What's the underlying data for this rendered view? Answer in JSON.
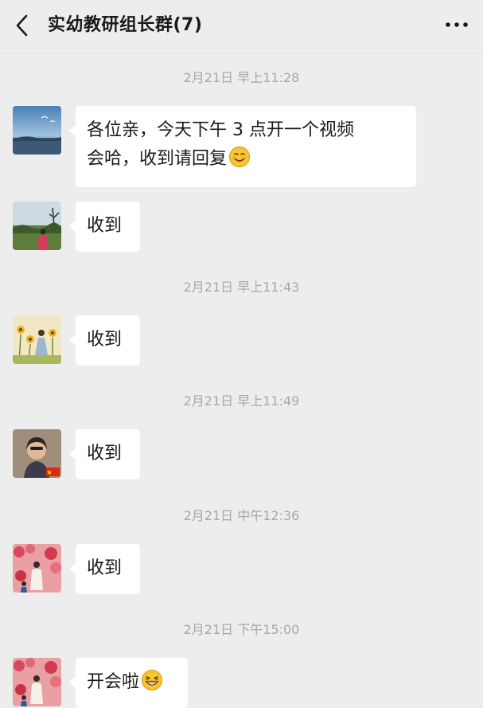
{
  "header": {
    "title": "实幼教研组长群(7)",
    "back_icon": "chevron-left-icon",
    "more_icon": "more-dots-icon"
  },
  "messages": [
    {
      "timestamp": "2月21日 早上11:28",
      "text": "各位亲，今天下午 3 点开一个视频",
      "text2": "会哈，收到请回复",
      "emoji": "smile-emoji-icon"
    },
    {
      "text": "收到"
    },
    {
      "timestamp": "2月21日 早上11:43",
      "text": "收到"
    },
    {
      "timestamp": "2月21日 早上11:49",
      "text": "收到"
    },
    {
      "timestamp": "2月21日 中午12:36",
      "text": "收到"
    },
    {
      "timestamp": "2月21日 下午15:00",
      "text": "开会啦",
      "emoji": "grin-emoji-icon"
    }
  ]
}
